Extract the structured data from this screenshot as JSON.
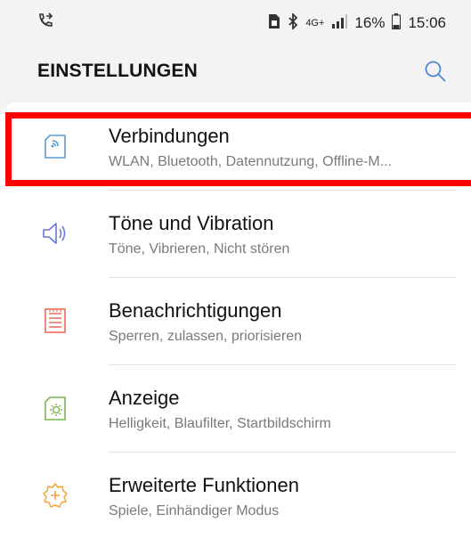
{
  "status_bar": {
    "left_icon": "call-forward-icon",
    "network": "4G+",
    "battery": "16%",
    "time": "15:06"
  },
  "header": {
    "title": "EINSTELLUNGEN",
    "search_icon": "search-icon"
  },
  "items": [
    {
      "label": "Verbindungen",
      "subtitle": "WLAN, Bluetooth, Datennutzung, Offline-M...",
      "icon": "connections-icon",
      "icon_color": "#5b9bd5"
    },
    {
      "label": "Töne und Vibration",
      "subtitle": "Töne, Vibrieren, Nicht stören",
      "icon": "speaker-icon",
      "icon_color": "#6b74e0"
    },
    {
      "label": "Benachrichtigungen",
      "subtitle": "Sperren, zulassen, priorisieren",
      "icon": "notifications-icon",
      "icon_color": "#ef6a5a"
    },
    {
      "label": "Anzeige",
      "subtitle": "Helligkeit, Blaufilter, Startbildschirm",
      "icon": "display-brightness-icon",
      "icon_color": "#78b84a"
    },
    {
      "label": "Erweiterte Funktionen",
      "subtitle": "Spiele, Einhändiger Modus",
      "icon": "advanced-features-icon",
      "icon_color": "#f2a53a"
    }
  ],
  "colors": {
    "highlight": "#ff0000",
    "accent": "#4b86d8"
  }
}
